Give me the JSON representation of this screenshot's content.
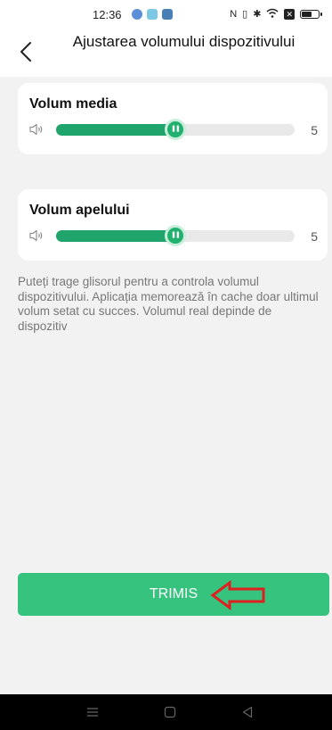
{
  "status_bar": {
    "time": "12:36",
    "app_icons": [
      "app-notification-icon",
      "weather-icon",
      "gallery-icon"
    ],
    "system_icons": [
      "nfc-icon",
      "vibrate-icon",
      "bluetooth-icon",
      "wifi-icon",
      "x-notification-icon",
      "battery-icon"
    ]
  },
  "header": {
    "back_icon": "chevron-left-icon",
    "title": "Ajustarea volumului dispozitivului"
  },
  "media_volume": {
    "label": "Volum media",
    "icon": "speaker-icon",
    "value": "5",
    "fill_fraction": 0.5
  },
  "call_volume": {
    "label": "Volum apelului",
    "icon": "speaker-icon",
    "value": "5",
    "fill_fraction": 0.5
  },
  "hint": "Puteți trage glisorul pentru a controla volumul dispozitivului. Aplicația memorează în cache doar ultimul volum setat cu succes. Volumul real depinde de dispozitiv",
  "submit": {
    "label": "TRIMIS"
  },
  "annotation": {
    "icon": "red-outline-arrow-left-icon",
    "color": "#e02020"
  },
  "nav_bar": {
    "icons": [
      "menu-icon",
      "home-square-icon",
      "back-triangle-icon"
    ]
  },
  "colors": {
    "accent": "#1fa56b",
    "button": "#35c37e",
    "background": "#f2f2f2",
    "track": "#e9e9e9"
  }
}
